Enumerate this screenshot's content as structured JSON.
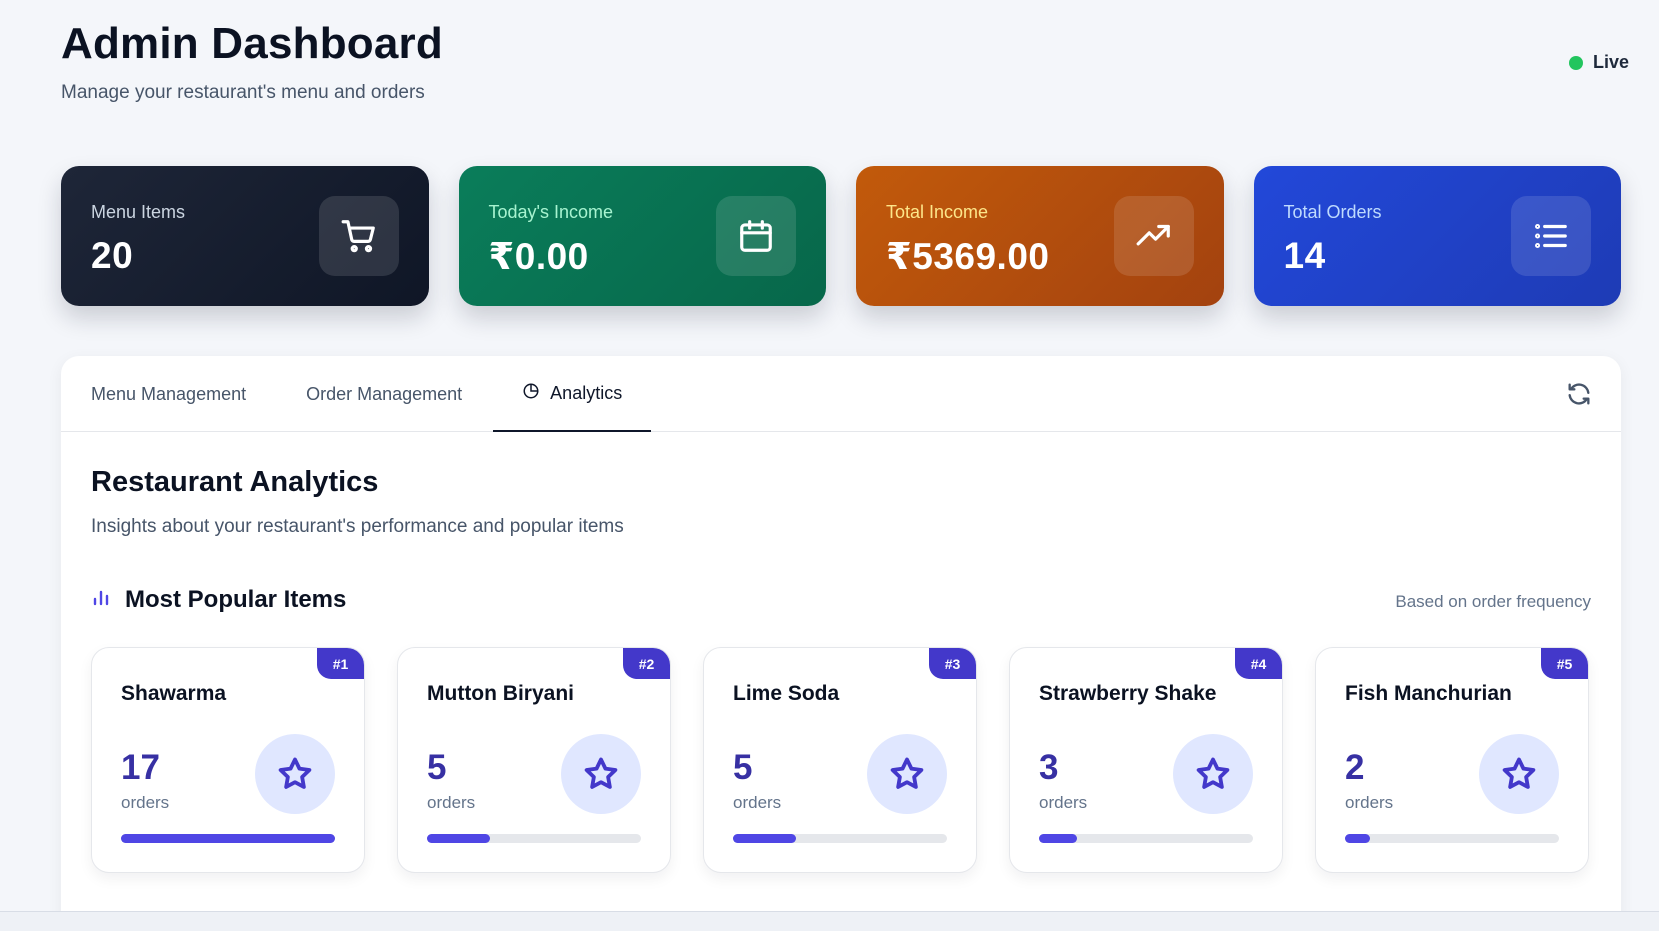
{
  "header": {
    "title": "Admin Dashboard",
    "subtitle": "Manage your restaurant's menu and orders",
    "status": "Live",
    "status_color": "#22c55e"
  },
  "stats": [
    {
      "label": "Menu Items",
      "value": "20",
      "icon": "cart-icon"
    },
    {
      "label": "Today's Income",
      "value": "₹0.00",
      "icon": "calendar-icon"
    },
    {
      "label": "Total Income",
      "value": "₹5369.00",
      "icon": "trending-up-icon"
    },
    {
      "label": "Total Orders",
      "value": "14",
      "icon": "list-icon"
    }
  ],
  "tabs": [
    {
      "label": "Menu Management",
      "active": false
    },
    {
      "label": "Order Management",
      "active": false
    },
    {
      "label": "Analytics",
      "active": true,
      "icon": "pie-chart-icon"
    }
  ],
  "analytics": {
    "title": "Restaurant Analytics",
    "subtitle": "Insights about your restaurant's performance and popular items",
    "popular": {
      "title": "Most Popular Items",
      "note": "Based on order frequency",
      "items": [
        {
          "rank": "#1",
          "name": "Shawarma",
          "count": "17",
          "unit": "orders",
          "share": 1.0
        },
        {
          "rank": "#2",
          "name": "Mutton Biryani",
          "count": "5",
          "unit": "orders",
          "share": 0.294
        },
        {
          "rank": "#3",
          "name": "Lime Soda",
          "count": "5",
          "unit": "orders",
          "share": 0.294
        },
        {
          "rank": "#4",
          "name": "Strawberry Shake",
          "count": "3",
          "unit": "orders",
          "share": 0.176
        },
        {
          "rank": "#5",
          "name": "Fish Manchurian",
          "count": "2",
          "unit": "orders",
          "share": 0.118
        }
      ]
    }
  },
  "colors": {
    "accent": "#4f46e5",
    "card_dark": "#1e2638",
    "card_green": "#0a7d5a",
    "card_orange": "#c25a0b",
    "card_blue": "#2248d9"
  }
}
